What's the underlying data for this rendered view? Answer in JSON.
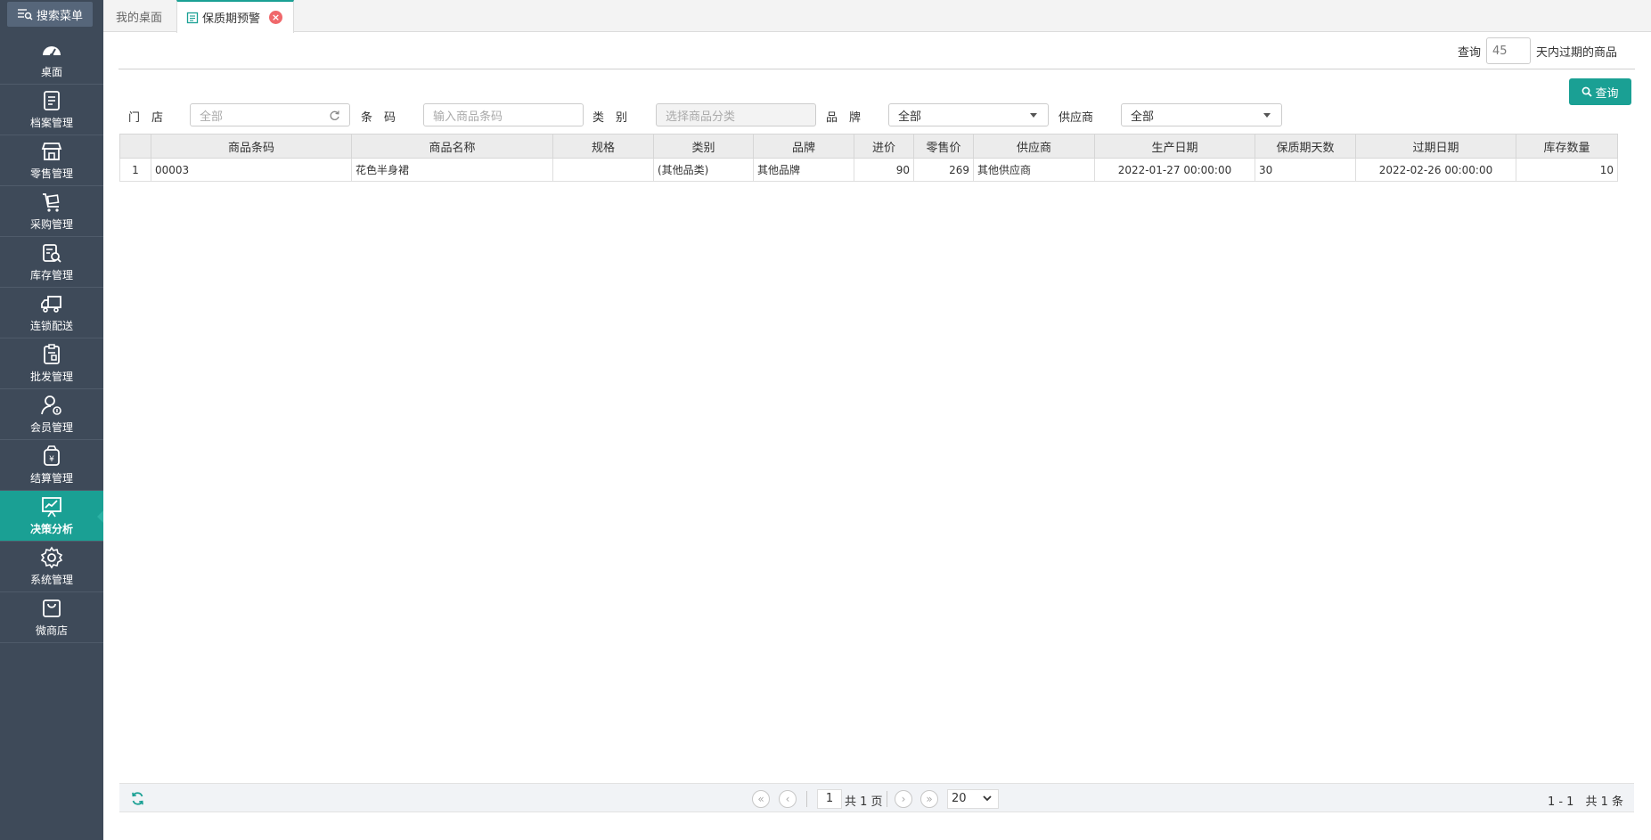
{
  "sidebar": {
    "search_label": "搜索菜单",
    "items": [
      {
        "label": "桌面",
        "icon": "dashboard-icon"
      },
      {
        "label": "档案管理",
        "icon": "archive-icon"
      },
      {
        "label": "零售管理",
        "icon": "store-icon"
      },
      {
        "label": "采购管理",
        "icon": "cart-icon"
      },
      {
        "label": "库存管理",
        "icon": "inventory-icon"
      },
      {
        "label": "连锁配送",
        "icon": "delivery-truck-icon"
      },
      {
        "label": "批发管理",
        "icon": "wholesale-icon"
      },
      {
        "label": "会员管理",
        "icon": "member-icon"
      },
      {
        "label": "结算管理",
        "icon": "settlement-icon"
      },
      {
        "label": "决策分析",
        "icon": "analytics-icon",
        "active": true
      },
      {
        "label": "系统管理",
        "icon": "settings-icon"
      },
      {
        "label": "微商店",
        "icon": "shop-bag-icon"
      }
    ]
  },
  "tabs": {
    "desktop": "我的桌面",
    "current": "保质期预警",
    "close_glyph": "×"
  },
  "top_query": {
    "prefix": "查询",
    "days_value": "45",
    "suffix": "天内过期的商品"
  },
  "query_button_label": "查询",
  "filters": {
    "store_label": "门　店",
    "store_value": "全部",
    "barcode_label": "条　码",
    "barcode_placeholder": "输入商品条码",
    "category_label": "类　别",
    "category_placeholder": "选择商品分类",
    "brand_label": "品　牌",
    "brand_value": "全部",
    "supplier_label": "供应商",
    "supplier_value": "全部"
  },
  "table": {
    "headers": [
      "",
      "商品条码",
      "商品名称",
      "规格",
      "类别",
      "品牌",
      "进价",
      "零售价",
      "供应商",
      "生产日期",
      "保质期天数",
      "过期日期",
      "库存数量"
    ],
    "rows": [
      [
        "1",
        "00003",
        "花色半身裙",
        "",
        "(其他品类)",
        "其他品牌",
        "90",
        "269",
        "其他供应商",
        "2022-01-27 00:00:00",
        "30",
        "2022-02-26 00:00:00",
        "10"
      ]
    ]
  },
  "pager": {
    "current_page": "1",
    "total_pages": "共 1 页",
    "page_size": "20",
    "record_info": "1 - 1　共 1 条",
    "first": "«",
    "prev": "‹",
    "next": "›",
    "last": "»"
  },
  "colors": {
    "sidebar_bg": "#3e4a59",
    "accent": "#1aa094",
    "close_red": "#f0686b"
  }
}
